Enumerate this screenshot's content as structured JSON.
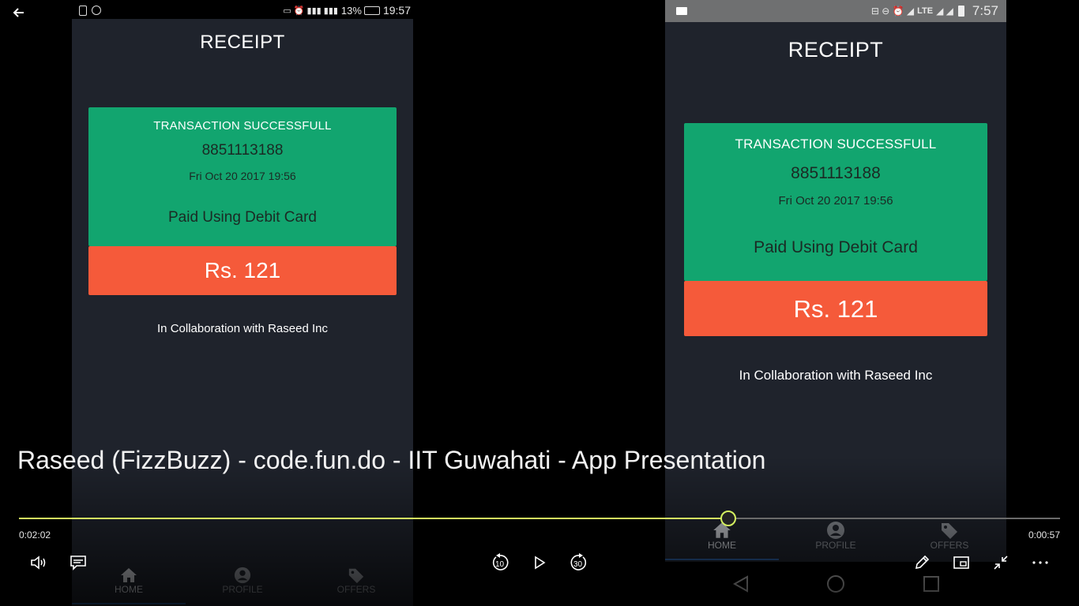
{
  "left_phone": {
    "status_time": "19:57",
    "status_battery": "13%",
    "title": "RECEIPT",
    "card": {
      "status": "TRANSACTION SUCCESSFULL",
      "phone_number": "8851113188",
      "datetime": "Fri Oct 20 2017 19:56",
      "method": "Paid Using Debit Card",
      "amount": "Rs. 121"
    },
    "collab": "In Collaboration with Raseed Inc",
    "tabs": [
      "HOME",
      "PROFILE",
      "OFFERS"
    ]
  },
  "right_phone": {
    "status_time": "7:57",
    "status_network": "LTE",
    "title": "RECEIPT",
    "card": {
      "status": "TRANSACTION SUCCESSFULL",
      "phone_number": "8851113188",
      "datetime": "Fri Oct 20 2017 19:56",
      "method": "Paid Using Debit Card",
      "amount": "Rs. 121"
    },
    "collab": "In Collaboration with Raseed Inc",
    "tabs": [
      "HOME",
      "PROFILE",
      "OFFERS"
    ]
  },
  "player": {
    "video_title": "Raseed (FizzBuzz) - code.fun.do - IIT Guwahati - App Presentation",
    "elapsed": "0:02:02",
    "remaining": "0:00:57",
    "progress_fraction": 0.681,
    "skip_back_label": "10",
    "skip_forward_label": "30",
    "accent_color": "#d4f060"
  },
  "icons": {
    "back": "arrow-left-icon",
    "volume": "volume-icon",
    "captions": "captions-icon",
    "skip_back": "skip-back-10-icon",
    "play": "play-icon",
    "skip_forward": "skip-forward-30-icon",
    "edit": "pencil-icon",
    "mini_view": "mini-view-icon",
    "exit_fullscreen": "exit-fullscreen-icon",
    "more": "more-icon"
  }
}
